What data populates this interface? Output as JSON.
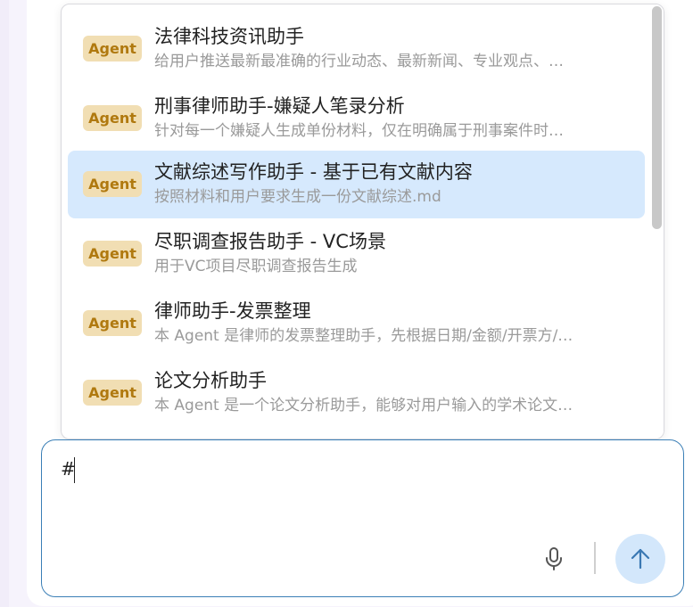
{
  "dropdown": {
    "items": [
      {
        "badge": "Agent",
        "title": "法律科技资讯助手",
        "desc": "给用户推送最新最准确的行业动态、最新新闻、专业观点、…"
      },
      {
        "badge": "Agent",
        "title": "刑事律师助手-嫌疑人笔录分析",
        "desc": "针对每一个嫌疑人生成单份材料，仅在明确属于刑事案件时…"
      },
      {
        "badge": "Agent",
        "title": "文献综述写作助手 - 基于已有文献内容",
        "desc": "按照材料和用户要求生成一份文献综述.md",
        "selected": true
      },
      {
        "badge": "Agent",
        "title": "尽职调查报告助手 - VC场景",
        "desc": "用于VC项目尽职调查报告生成"
      },
      {
        "badge": "Agent",
        "title": "律师助手-发票整理",
        "desc": "本 Agent 是律师的发票整理助手，先根据日期/金额/开票方/…"
      },
      {
        "badge": "Agent",
        "title": "论文分析助手",
        "desc": "本 Agent 是一个论文分析助手，能够对用户输入的学术论文…"
      }
    ]
  },
  "composer": {
    "value": "#"
  },
  "icons": {
    "mic": "microphone-icon",
    "send": "arrow-up-icon"
  },
  "colors": {
    "badge_bg": "#f1deb3",
    "badge_text": "#b0790f",
    "selected_bg": "#d6e9fd",
    "input_border": "#3b7fb6",
    "send_bg": "#d3e7fb"
  }
}
